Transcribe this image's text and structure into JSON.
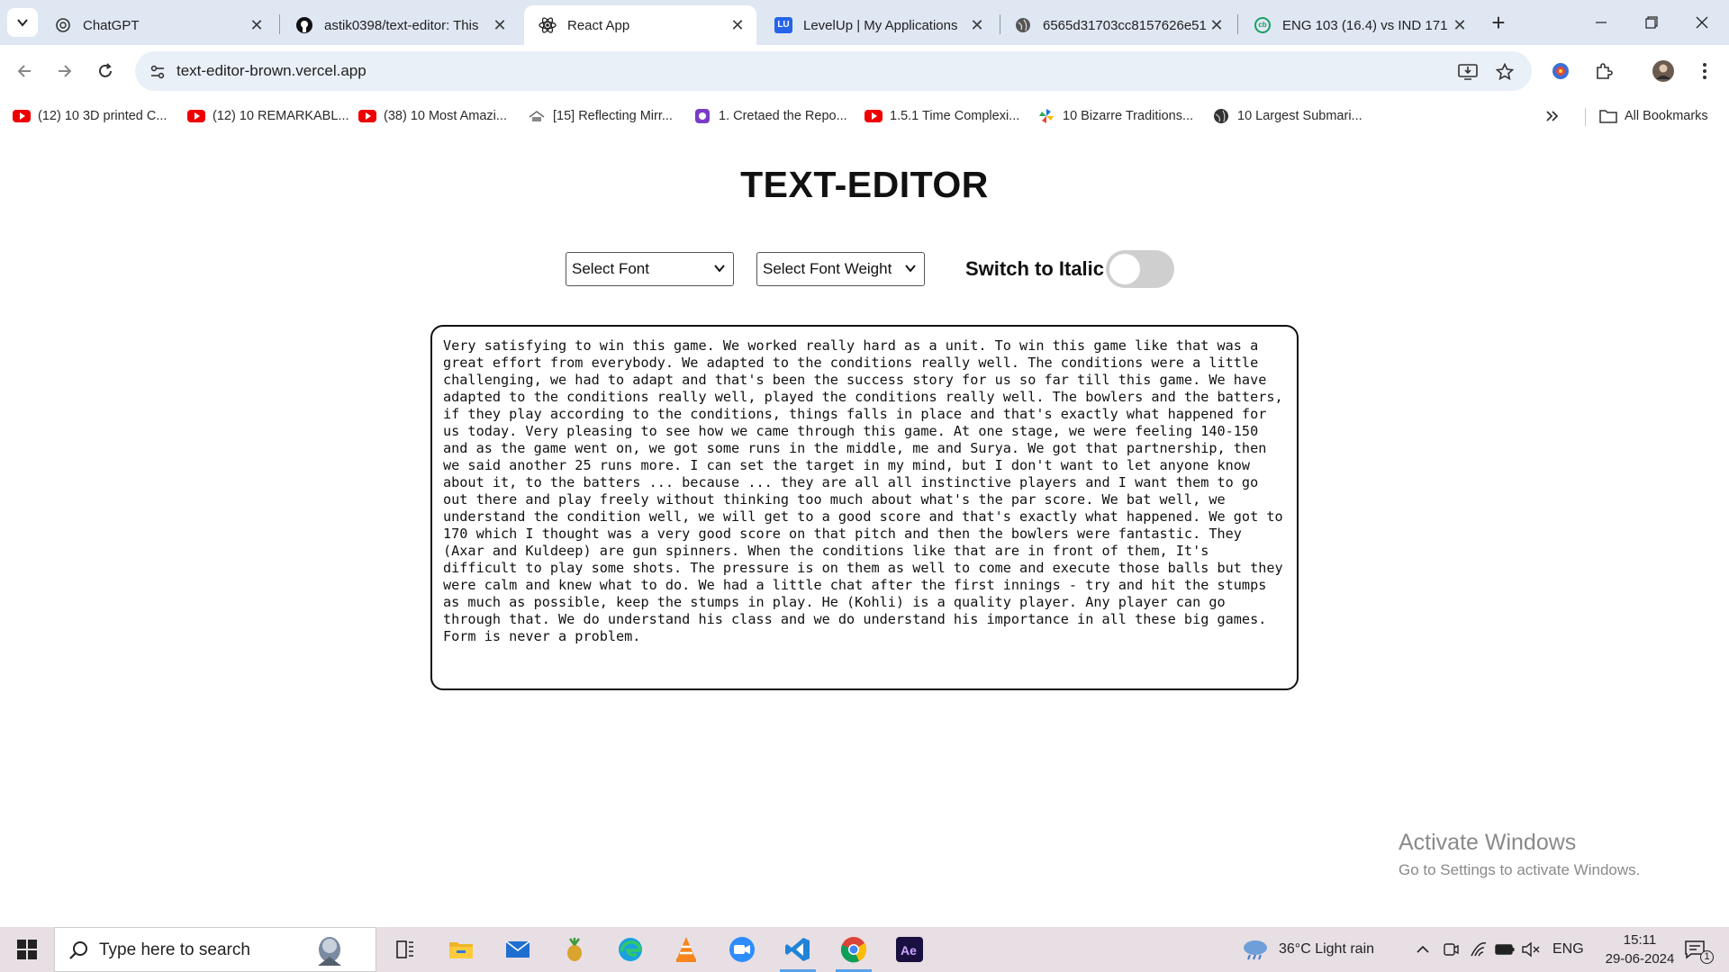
{
  "browser": {
    "tabs": [
      {
        "title": "ChatGPT",
        "icon": "chatgpt-icon"
      },
      {
        "title": "astik0398/text-editor: This",
        "icon": "github-icon"
      },
      {
        "title": "React App",
        "icon": "react-icon"
      },
      {
        "title": "LevelUp | My Applications",
        "icon": "levelup-icon",
        "badge": "LU"
      },
      {
        "title": "6565d31703cc8157626e51",
        "icon": "globe-icon"
      },
      {
        "title": "ENG 103 (16.4) vs IND 171",
        "icon": "cricbuzz-icon",
        "badge": "cb"
      }
    ],
    "url": "text-editor-brown.vercel.app",
    "bookmarks": [
      {
        "label": "(12) 10 3D printed C...",
        "icon": "youtube-icon"
      },
      {
        "label": "(12) 10 REMARKABL...",
        "icon": "youtube-icon"
      },
      {
        "label": "(38) 10 Most Amazi...",
        "icon": "youtube-icon"
      },
      {
        "label": "[15] Reflecting Mirr...",
        "icon": "reddit-like-icon"
      },
      {
        "label": "1. Cretaed the Repo...",
        "icon": "bug-icon"
      },
      {
        "label": "1.5.1 Time Complexi...",
        "icon": "youtube-icon"
      },
      {
        "label": "10 Bizarre Traditions...",
        "icon": "pinwheel-icon"
      },
      {
        "label": "10 Largest Submari...",
        "icon": "globe-icon"
      }
    ],
    "all_bookmarks": "All Bookmarks"
  },
  "app": {
    "title": "TEXT-EDITOR",
    "font_select": "Select Font",
    "weight_select": "Select Font Weight",
    "italic_label": "Switch to Italic",
    "italic_on": false,
    "text": "Very satisfying to win this game. We worked really hard as a unit. To win this game like that was a great effort from everybody. We adapted to the conditions really well. The conditions were a little challenging, we had to adapt and that's been the success story for us so far till this game. We have adapted to the conditions really well, played the conditions really well. The bowlers and the batters, if they play according to the conditions, things falls in place and that's exactly what happened for us today. Very pleasing to see how we came through this game. At one stage, we were feeling 140-150 and as the game went on, we got some runs in the middle, me and Surya. We got that partnership, then we said another 25 runs more. I can set the target in my mind, but I don't want to let anyone know about it, to the batters ... because ... they are all all instinctive players and I want them to go out there and play freely without thinking too much about what's the par score. We bat well, we understand the condition well, we will get to a good score and that's exactly what happened. We got to 170 which I thought was a very good score on that pitch and then the bowlers were fantastic. They (Axar and Kuldeep) are gun spinners. When the conditions like that are in front of them, It's difficult to play some shots. The pressure is on them as well to come and execute those balls but they were calm and knew what to do. We had a little chat after the first innings - try and hit the stumps as much as possible, keep the stumps in play. He (Kohli) is a quality player. Any player can go through that. We do understand his class and we do understand his importance in all these big games. Form is never a problem."
  },
  "watermark": {
    "line1": "Activate Windows",
    "line2": "Go to Settings to activate Windows."
  },
  "taskbar": {
    "search_placeholder": "Type here to search",
    "weather": "36°C  Light rain",
    "lang": "ENG",
    "time": "15:11",
    "date": "29-06-2024",
    "notifications": "1"
  }
}
